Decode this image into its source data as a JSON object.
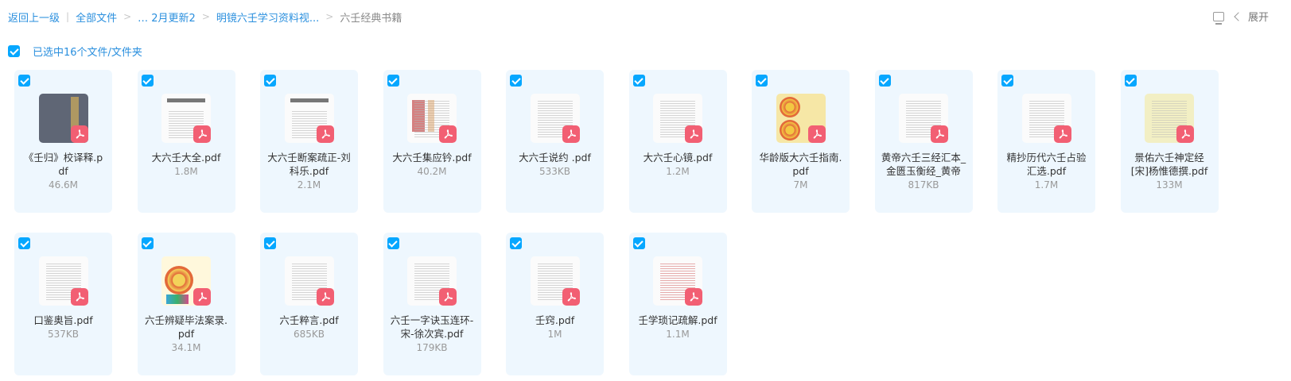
{
  "breadcrumb": {
    "back": "返回上一级",
    "all_files": "全部文件",
    "ellipsis_path": "… 2月更新2",
    "parent": "明镜六壬学习资料视...",
    "current": "六壬经典书籍"
  },
  "toolbar": {
    "expand_label": "展开"
  },
  "selection": {
    "label": "已选中16个文件/文件夹"
  },
  "files": [
    {
      "name": "《壬归》校译释.pdf",
      "size": "46.6M"
    },
    {
      "name": "大六壬大全.pdf",
      "size": "1.8M"
    },
    {
      "name": "大六壬断案疏正-刘科乐.pdf",
      "size": "2.1M"
    },
    {
      "name": "大六壬集应钤.pdf",
      "size": "40.2M"
    },
    {
      "name": "大六壬说约 .pdf",
      "size": "533KB"
    },
    {
      "name": "大六壬心镜.pdf",
      "size": "1.2M"
    },
    {
      "name": "华龄版大六壬指南.pdf",
      "size": "7M"
    },
    {
      "name": "黄帝六壬三经汇本_金匮玉衡经_黄帝",
      "size": "817KB"
    },
    {
      "name": "精抄历代六壬占验汇选.pdf",
      "size": "1.7M"
    },
    {
      "name": "景佑六壬神定经[宋]杨惟德撰.pdf",
      "size": "133M"
    },
    {
      "name": "口鉴奥旨.pdf",
      "size": "537KB"
    },
    {
      "name": "六壬辨疑毕法案录.pdf",
      "size": "34.1M"
    },
    {
      "name": "六壬粹言.pdf",
      "size": "685KB"
    },
    {
      "name": "六壬一字诀玉连环-宋-徐次宾.pdf",
      "size": "179KB"
    },
    {
      "name": "壬窍.pdf",
      "size": "1M"
    },
    {
      "name": "壬学琐记疏解.pdf",
      "size": "1.1M"
    }
  ],
  "colors": {
    "accent": "#06a7ff",
    "link": "#2a8fde",
    "card_bg": "#eef7fe",
    "pdf_badge": "#f25f73"
  },
  "icons": {
    "checkbox": "checkbox-checked-icon",
    "file_type": "pdf-icon",
    "view": "list-view-icon",
    "expand": "chevron-left-icon"
  }
}
